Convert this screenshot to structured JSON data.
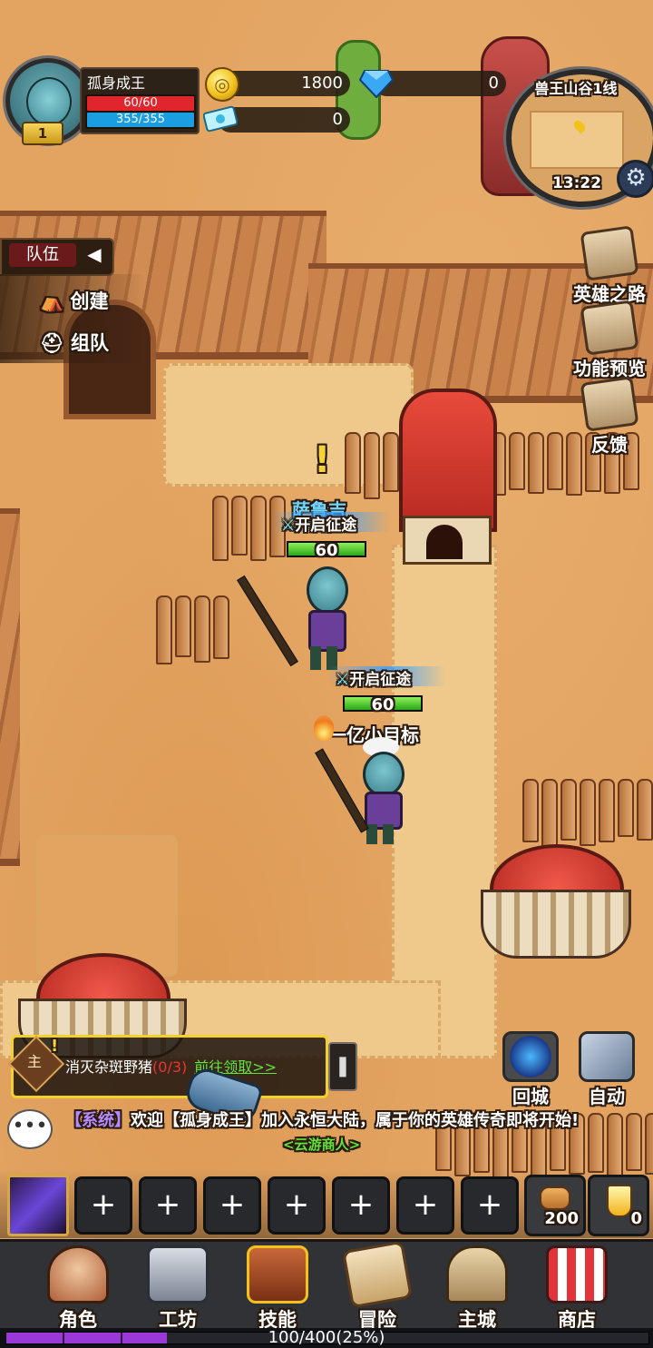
{
  "player": {
    "name": "孤身成王",
    "level": "1",
    "hp": "60/60",
    "mp": "355/355"
  },
  "currency": {
    "gold": "1800",
    "diamond": "0",
    "ticket": "0"
  },
  "minimap": {
    "name": "兽王山谷1线",
    "time": "13:22"
  },
  "team": {
    "title": "队伍",
    "create": "创建",
    "group": "组队"
  },
  "side_buttons": {
    "hero_road": "英雄之路",
    "preview": "功能预览",
    "feedback": "反馈"
  },
  "npcs": [
    {
      "name": "萨鲁吉",
      "tag": "开启征途",
      "hp": "60"
    },
    {
      "name": "一亿小目标",
      "tag": "开启征途",
      "hp": "60"
    }
  ],
  "quest": {
    "badge": "主",
    "text": "消灭杂斑野猪",
    "count": "(0/3)",
    "link": "前往领取>>"
  },
  "actions": {
    "return_city": "回城",
    "auto": "自动"
  },
  "chat": {
    "system": "【系统】",
    "message": "欢迎【孤身成王】加入永恒大陆，属于你的英雄传奇即将开始!",
    "merchant": "<云游商人>"
  },
  "skills": {
    "slot_plus": "+"
  },
  "items": [
    {
      "icon": "bread-icon",
      "count": "200"
    },
    {
      "icon": "potion-icon",
      "count": "0"
    }
  ],
  "nav": [
    "角色",
    "工坊",
    "技能",
    "冒险",
    "主城",
    "商店"
  ],
  "exp": {
    "text": "100/400(25%)",
    "ratio": 0.25
  },
  "colors": {
    "hp": "#e0262c",
    "mp": "#1b9de2",
    "quest_border": "#f2d12a",
    "link": "#5fe33a",
    "exp": "#9a39d8"
  }
}
